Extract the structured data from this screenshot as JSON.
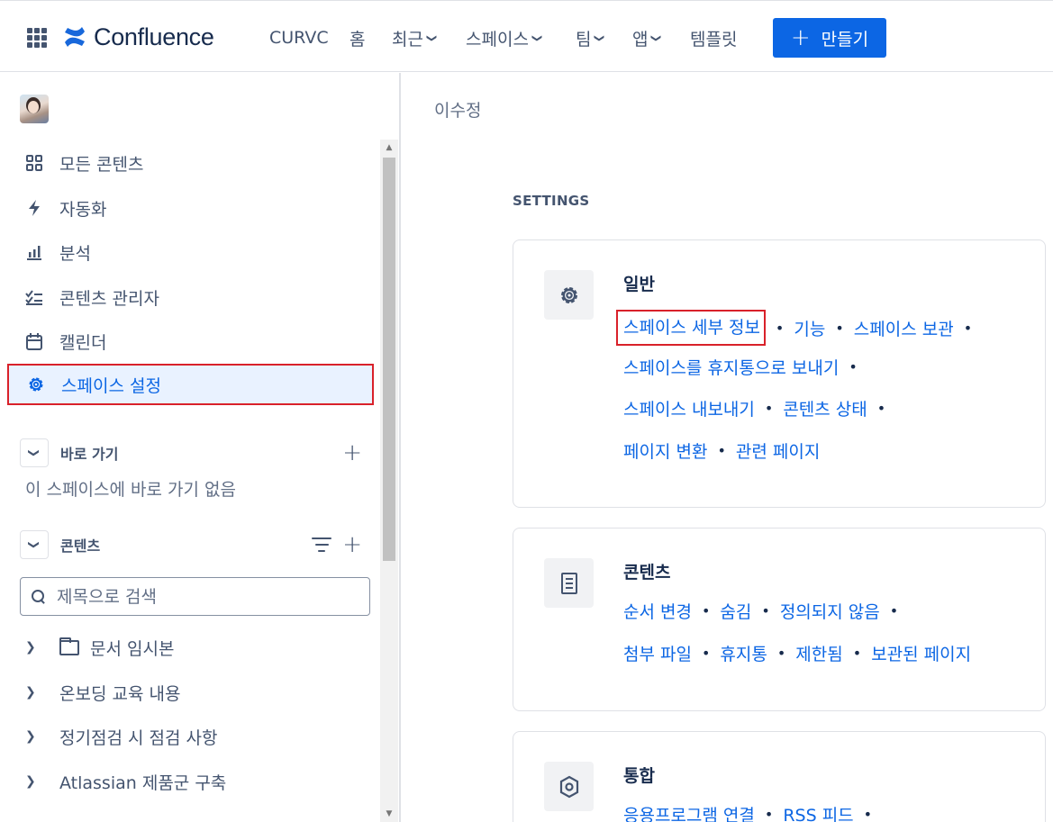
{
  "topnav": {
    "brand": "Confluence",
    "items": [
      {
        "label": "CURVC",
        "has_chevron": false
      },
      {
        "label": "홈",
        "has_chevron": false
      },
      {
        "label": "최근",
        "has_chevron": true
      },
      {
        "label": "스페이스",
        "has_chevron": true
      },
      {
        "label": "팀",
        "has_chevron": true
      },
      {
        "label": "앱",
        "has_chevron": true
      },
      {
        "label": "템플릿",
        "has_chevron": false
      }
    ],
    "create_label": "만들기",
    "accent": "#0c66e4"
  },
  "sidebar": {
    "items": [
      {
        "label": "모든 콘텐츠",
        "icon": "grid-icon"
      },
      {
        "label": "자동화",
        "icon": "lightning-icon"
      },
      {
        "label": "분석",
        "icon": "bar-chart-icon"
      },
      {
        "label": "콘텐츠 관리자",
        "icon": "checklist-icon"
      },
      {
        "label": "캘린더",
        "icon": "calendar-icon"
      },
      {
        "label": "스페이스 설정",
        "icon": "gear-icon",
        "active": true
      }
    ],
    "shortcuts": {
      "title": "바로 가기",
      "empty_text": "이 스페이스에 바로 가기 없음"
    },
    "content": {
      "title": "콘텐츠",
      "search_placeholder": "제목으로 검색",
      "tree": [
        {
          "label": "문서 임시본",
          "icon": "folder-icon"
        },
        {
          "label": "온보딩 교육 내용"
        },
        {
          "label": "정기점검 시 점검 사항"
        },
        {
          "label": "Atlassian 제품군 구축"
        }
      ]
    }
  },
  "main": {
    "breadcrumb": "이수정",
    "settings_title": "SETTINGS",
    "cards": [
      {
        "title": "일반",
        "icon": "gear-icon",
        "lines": [
          [
            "스페이스 세부 정보",
            "기능",
            "스페이스 보관"
          ],
          [
            "스페이스를 휴지통으로 보내기"
          ],
          [
            "스페이스 내보내기",
            "콘텐츠 상태"
          ],
          [
            "페이지 변환",
            "관련 페이지"
          ]
        ]
      },
      {
        "title": "콘텐츠",
        "icon": "document-icon",
        "lines": [
          [
            "순서 변경",
            "숨김",
            "정의되지 않음"
          ],
          [
            "첨부 파일",
            "휴지통",
            "제한됨",
            "보관된 페이지"
          ]
        ]
      },
      {
        "title": "통합",
        "icon": "hexagon-icon",
        "lines": [
          [
            "응용프로그램 연결",
            "RSS 피드"
          ]
        ]
      }
    ]
  }
}
